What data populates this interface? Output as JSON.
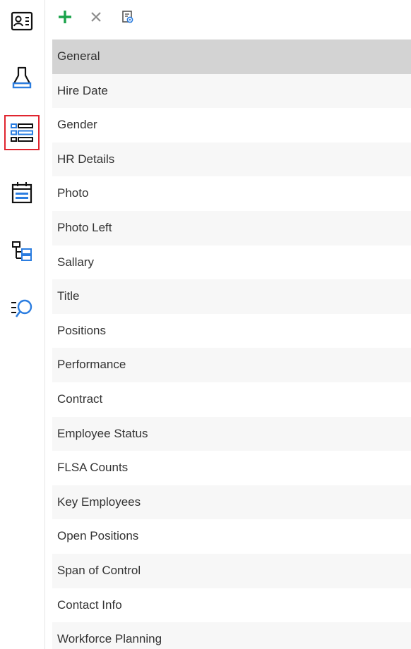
{
  "rail": {
    "items": [
      {
        "name": "contact-card-icon",
        "active": false
      },
      {
        "name": "paint-brush-icon",
        "active": false
      },
      {
        "name": "list-view-icon",
        "active": true
      },
      {
        "name": "calendar-board-icon",
        "active": false
      },
      {
        "name": "tree-structure-icon",
        "active": false
      },
      {
        "name": "search-list-icon",
        "active": false
      }
    ],
    "active_border_color": "#e0252f",
    "icon_blue": "#2b7de0"
  },
  "toolbar": {
    "add_icon": "plus-icon",
    "add_color": "#1aa34a",
    "delete_icon": "close-icon",
    "properties_icon": "document-settings-icon"
  },
  "list": {
    "selected_index": 0,
    "items": [
      "General",
      "Hire Date",
      "Gender",
      "HR Details",
      "Photo",
      "Photo Left",
      "Sallary",
      "Title",
      "Positions",
      "Performance",
      "Contract",
      "Employee Status",
      "FLSA Counts",
      "Key Employees",
      "Open Positions",
      "Span of Control",
      "Contact Info",
      "Workforce Planning"
    ]
  }
}
